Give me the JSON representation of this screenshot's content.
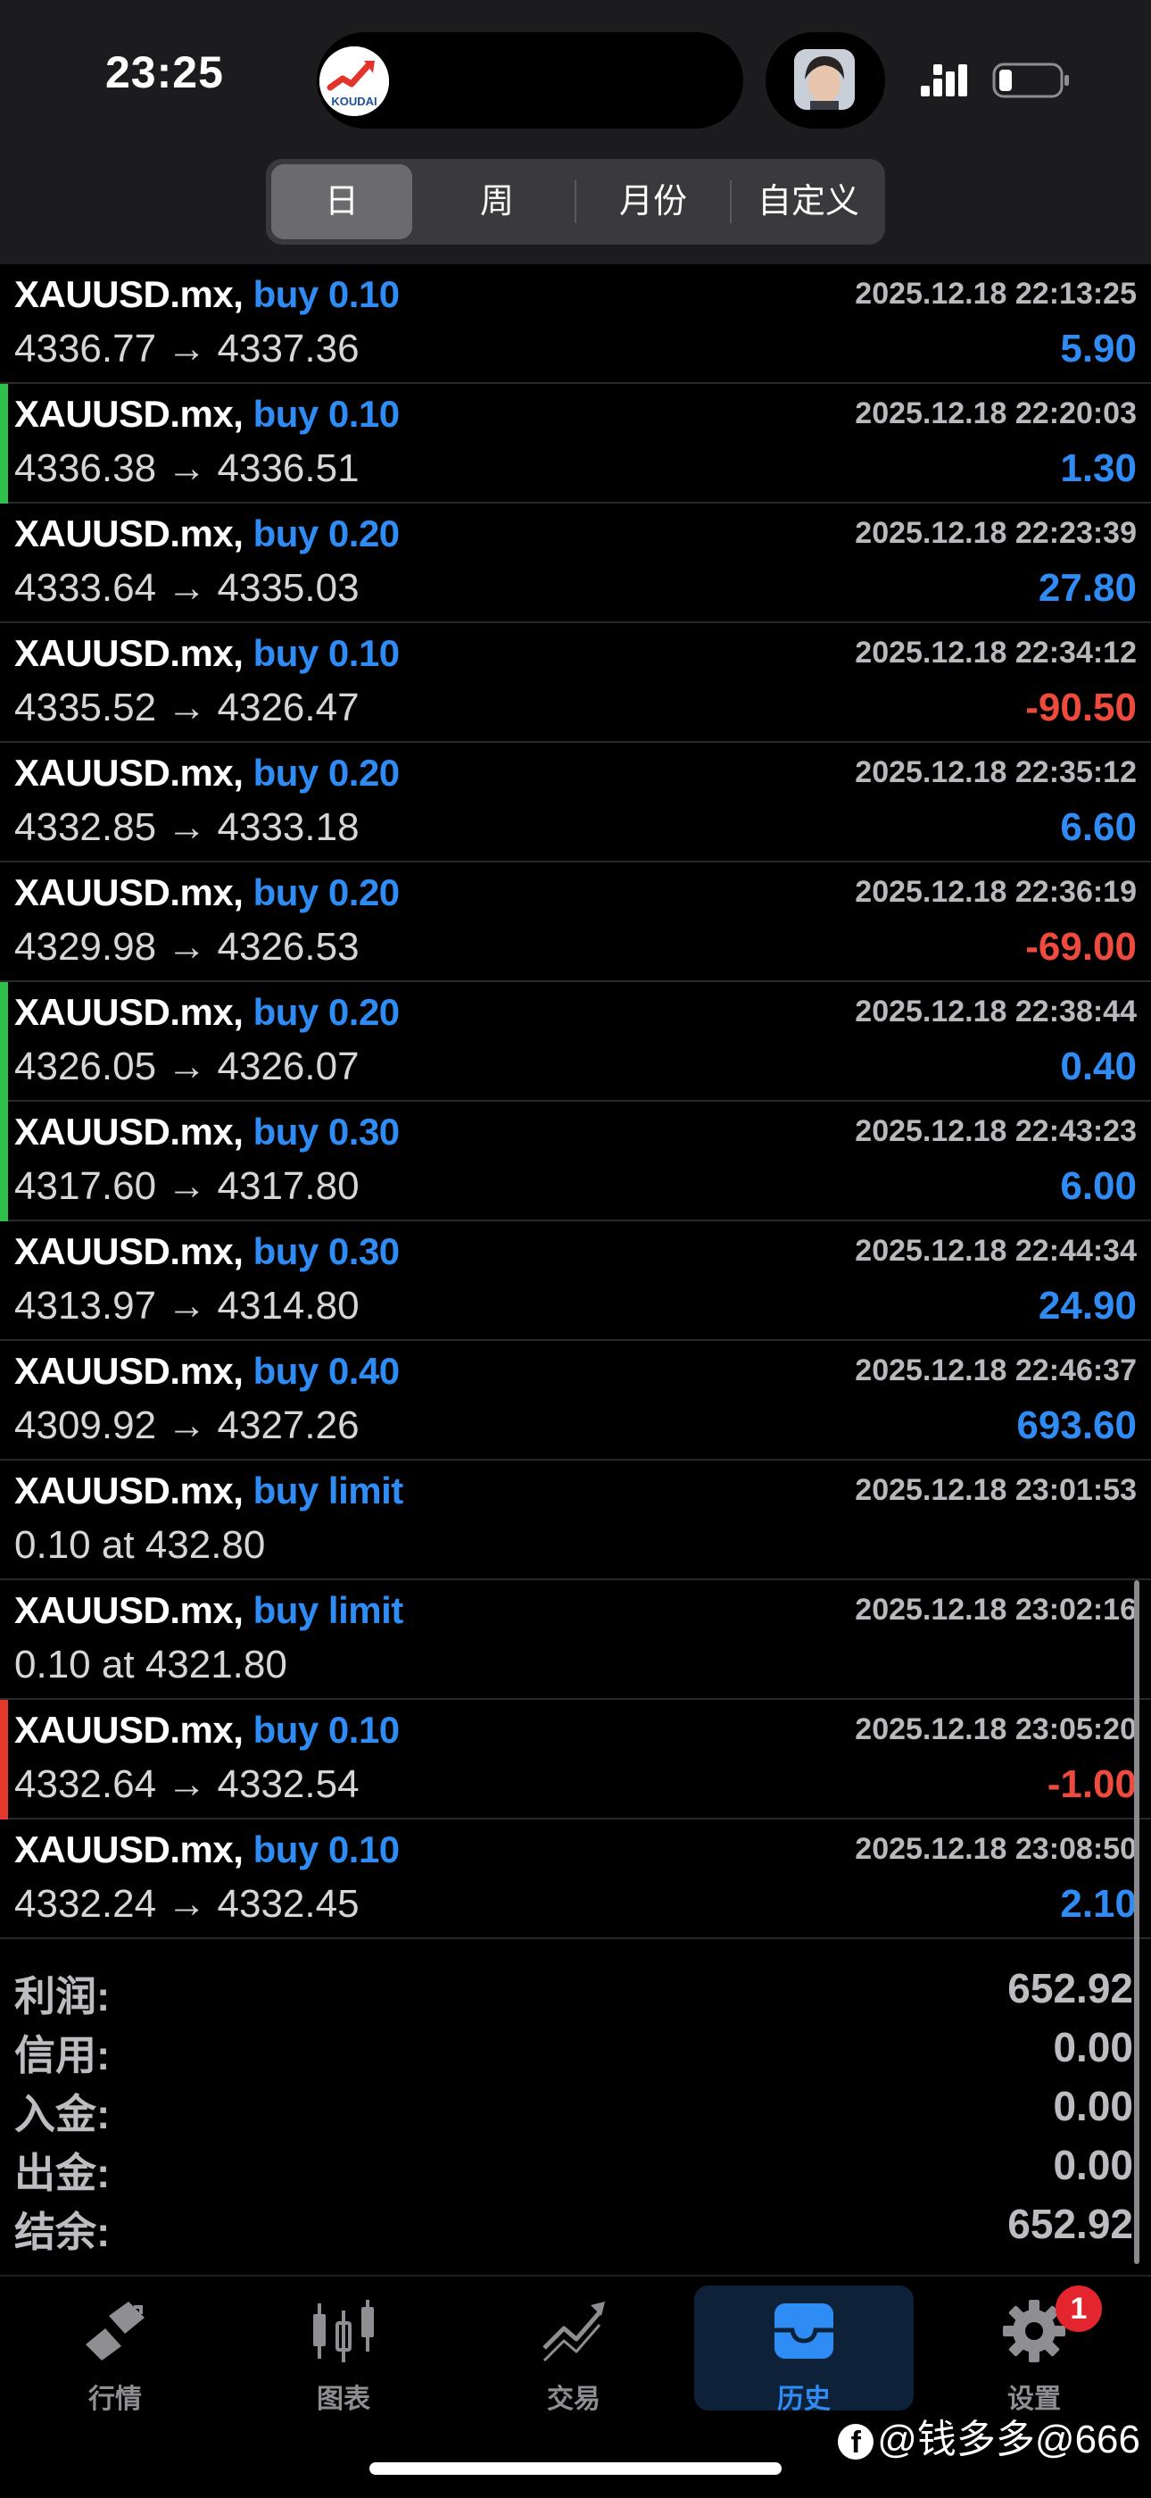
{
  "status_bar": {
    "time": "23:25",
    "app_name": "KOUDAI"
  },
  "segments": [
    {
      "label": "日",
      "active": true
    },
    {
      "label": "周",
      "active": false
    },
    {
      "label": "月份",
      "active": false
    },
    {
      "label": "自定义",
      "active": false
    }
  ],
  "trades": [
    {
      "symbol": "XAUUSD.mx,",
      "type": "buy 0.10",
      "time": "2025.12.18 22:13:25",
      "prices": "4336.77 → 4337.36",
      "profit": "5.90",
      "negative": false,
      "stripe": ""
    },
    {
      "symbol": "XAUUSD.mx,",
      "type": "buy 0.10",
      "time": "2025.12.18 22:20:03",
      "prices": "4336.38 → 4336.51",
      "profit": "1.30",
      "negative": false,
      "stripe": "#2fbf4b"
    },
    {
      "symbol": "XAUUSD.mx,",
      "type": "buy 0.20",
      "time": "2025.12.18 22:23:39",
      "prices": "4333.64 → 4335.03",
      "profit": "27.80",
      "negative": false,
      "stripe": ""
    },
    {
      "symbol": "XAUUSD.mx,",
      "type": "buy 0.10",
      "time": "2025.12.18 22:34:12",
      "prices": "4335.52 → 4326.47",
      "profit": "-90.50",
      "negative": true,
      "stripe": ""
    },
    {
      "symbol": "XAUUSD.mx,",
      "type": "buy 0.20",
      "time": "2025.12.18 22:35:12",
      "prices": "4332.85 → 4333.18",
      "profit": "6.60",
      "negative": false,
      "stripe": ""
    },
    {
      "symbol": "XAUUSD.mx,",
      "type": "buy 0.20",
      "time": "2025.12.18 22:36:19",
      "prices": "4329.98 → 4326.53",
      "profit": "-69.00",
      "negative": true,
      "stripe": ""
    },
    {
      "symbol": "XAUUSD.mx,",
      "type": "buy 0.20",
      "time": "2025.12.18 22:38:44",
      "prices": "4326.05 → 4326.07",
      "profit": "0.40",
      "negative": false,
      "stripe": "#2fbf4b"
    },
    {
      "symbol": "XAUUSD.mx,",
      "type": "buy 0.30",
      "time": "2025.12.18 22:43:23",
      "prices": "4317.60 → 4317.80",
      "profit": "6.00",
      "negative": false,
      "stripe": "#2fbf4b"
    },
    {
      "symbol": "XAUUSD.mx,",
      "type": "buy 0.30",
      "time": "2025.12.18 22:44:34",
      "prices": "4313.97 → 4314.80",
      "profit": "24.90",
      "negative": false,
      "stripe": ""
    },
    {
      "symbol": "XAUUSD.mx,",
      "type": "buy 0.40",
      "time": "2025.12.18 22:46:37",
      "prices": "4309.92 → 4327.26",
      "profit": "693.60",
      "negative": false,
      "stripe": ""
    },
    {
      "symbol": "XAUUSD.mx,",
      "type": "buy limit",
      "time": "2025.12.18 23:01:53",
      "prices": "0.10 at 432.80",
      "profit": "",
      "negative": false,
      "stripe": ""
    },
    {
      "symbol": "XAUUSD.mx,",
      "type": "buy limit",
      "time": "2025.12.18 23:02:16",
      "prices": "0.10 at 4321.80",
      "profit": "",
      "negative": false,
      "stripe": ""
    },
    {
      "symbol": "XAUUSD.mx,",
      "type": "buy 0.10",
      "time": "2025.12.18 23:05:20",
      "prices": "4332.64 → 4332.54",
      "profit": "-1.00",
      "negative": true,
      "stripe": "#e5392e"
    },
    {
      "symbol": "XAUUSD.mx,",
      "type": "buy 0.10",
      "time": "2025.12.18 23:08:50",
      "prices": "4332.24 → 4332.45",
      "profit": "2.10",
      "negative": false,
      "stripe": ""
    }
  ],
  "summary": [
    {
      "label": "利润:",
      "value": "652.92"
    },
    {
      "label": "信用:",
      "value": "0.00"
    },
    {
      "label": "入金:",
      "value": "0.00"
    },
    {
      "label": "出金:",
      "value": "0.00"
    },
    {
      "label": "结余:",
      "value": "652.92"
    }
  ],
  "tabbar": [
    {
      "label": "行情",
      "icon": "quotes-icon",
      "active": false
    },
    {
      "label": "图表",
      "icon": "chart-candles-icon",
      "active": false
    },
    {
      "label": "交易",
      "icon": "trade-icon",
      "active": false
    },
    {
      "label": "历史",
      "icon": "history-inbox-icon",
      "active": true
    },
    {
      "label": "设置",
      "icon": "settings-gear-icon",
      "active": false
    }
  ],
  "settings_badge": "1",
  "watermark": "@钱多多@666",
  "colors": {
    "accent": "#2f8cf5",
    "negative": "#ee4b3e",
    "profit_stripe": "#2fbf4b",
    "loss_stripe": "#e5392e"
  }
}
